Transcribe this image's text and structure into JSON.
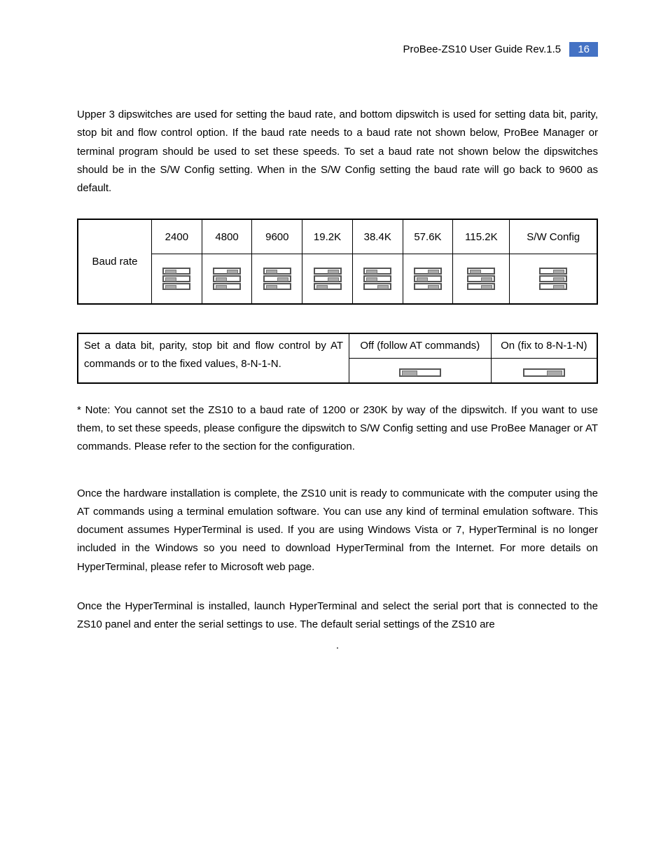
{
  "header": {
    "title": "ProBee-ZS10 User Guide Rev.1.5",
    "page": "16"
  },
  "p1": "Upper 3 dipswitches are used for setting the baud rate, and bottom dipswitch is used for setting data bit, parity, stop bit and flow control option. If the baud rate needs to a baud rate not shown below, ProBee Manager or terminal program should be used to set these speeds. To set a baud rate not shown below the dipswitches should be in the S/W Config setting. When in the S/W Config setting the baud rate will go back to 9600 as default.",
  "baud": {
    "row_label": "Baud rate",
    "cols": [
      "2400",
      "4800",
      "9600",
      "19.2K",
      "38.4K",
      "57.6K",
      "115.2K",
      "S/W Config"
    ],
    "switches": [
      [
        "left",
        "left",
        "left"
      ],
      [
        "right",
        "left",
        "left"
      ],
      [
        "left",
        "right",
        "left"
      ],
      [
        "right",
        "right",
        "left"
      ],
      [
        "left",
        "left",
        "right"
      ],
      [
        "right",
        "left",
        "right"
      ],
      [
        "left",
        "right",
        "right"
      ],
      [
        "right",
        "right",
        "right"
      ]
    ]
  },
  "cfg": {
    "left": "Set a data bit, parity, stop bit and flow control by AT commands or to the fixed values, 8-N-1-N.",
    "off_label": "Off (follow AT commands)",
    "on_label": "On (fix to 8-N-1-N)",
    "off_pos": "left",
    "on_pos": "right"
  },
  "note": "* Note: You cannot set the ZS10 to a baud rate of 1200 or 230K by way of the dipswitch. If you want to use them, to set these speeds, please configure the dipswitch to S/W Config setting and use ProBee Manager or AT commands. Please refer to the section               for the configuration.",
  "p2": "Once the hardware installation is complete, the ZS10 unit is ready to communicate with the computer using the AT commands using a terminal emulation software. You can use any kind of terminal emulation software. This document assumes HyperTerminal is used. If you are using Windows Vista or 7, HyperTerminal is no longer included in the Windows so you need to download HyperTerminal from the Internet. For more details on HyperTerminal, please refer to Microsoft web page.",
  "p3": "Once the HyperTerminal is installed, launch HyperTerminal and select the serial port that is connected to the ZS10 panel and enter the serial settings to use. The default serial settings of the ZS10 are",
  "p3_trail": "."
}
